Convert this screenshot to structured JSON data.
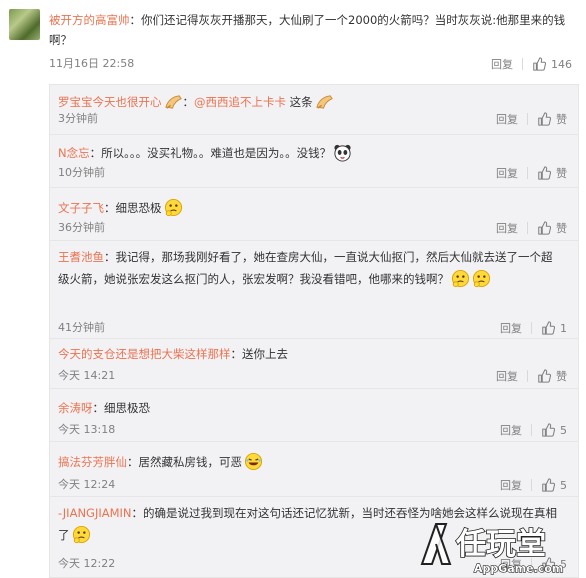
{
  "main_comment": {
    "username": "被开方的高富帅",
    "text": "：你们还记得灰灰开播那天，大仙刷了一个2000的火箭吗？当时灰灰说:他那里来的钱啊？",
    "time": "11月16日 22:58",
    "reply_label": "回复",
    "like_count": "146"
  },
  "replies": [
    {
      "username": "罗宝宝今天也很开心",
      "mention": "@西西追不上卡卡",
      "text": "这条",
      "time": "3分钟前",
      "reply_label": "回复",
      "like": "赞",
      "emoji": "bow"
    },
    {
      "username": "N念忘",
      "text": "：所以。。。没买礼物。。难道也是因为。。没钱？",
      "time": "10分钟前",
      "reply_label": "回复",
      "like": "赞",
      "emoji": "panda"
    },
    {
      "username": "文子子飞",
      "text": "：细思恐极",
      "time": "36分钟前",
      "reply_label": "回复",
      "like": "赞",
      "emoji": "think"
    },
    {
      "username": "王耆池鱼",
      "text": "：我记得，那场我刚好看了，她在查房大仙，一直说大仙抠门，然后大仙就去送了一个超级火箭，她说张宏发这么抠门的人，张宏发啊？我没看错吧，他哪来的钱啊？",
      "time": "41分钟前",
      "reply_label": "回复",
      "like": "1",
      "emoji": "think"
    },
    {
      "username": "今天的支仓还是想把大柴这样那样",
      "text": "：送你上去",
      "time": "今天 14:21",
      "reply_label": "回复",
      "like": "赞"
    },
    {
      "username": "余涛呀",
      "text": "：细思极恐",
      "time": "今天 13:18",
      "reply_label": "回复",
      "like": "5"
    },
    {
      "username": "搞法芬芳胖仙",
      "text": "：居然藏私房钱，可恶",
      "time": "今天 12:24",
      "reply_label": "回复",
      "like": "5",
      "emoji": "laugh"
    },
    {
      "username": "-JIANGJIAMIN",
      "text": "：的确是说过我到现在对这句话还记忆犹新，当时还吞怪为啥她会这样么说现在真相了",
      "time": "今天 12:22",
      "reply_label": "回复",
      "like": "5",
      "emoji": "think"
    }
  ],
  "watermark": {
    "name": "任玩堂",
    "domain": "AppGame.com"
  },
  "colors": {
    "username": "#eb7350",
    "text": "#333333",
    "meta": "#808080",
    "reply_bg": "#f2f2f5"
  }
}
